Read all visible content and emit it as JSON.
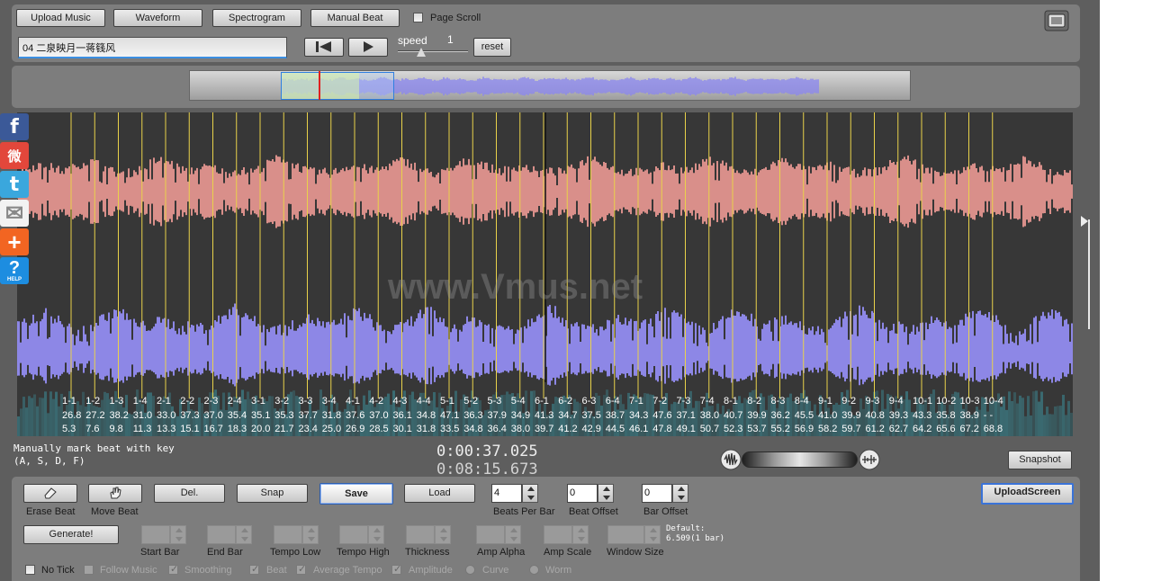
{
  "header": {
    "upload_music": "Upload Music",
    "waveform": "Waveform",
    "spectrogram": "Spectrogram",
    "manual_beat": "Manual Beat",
    "page_scroll": "Page Scroll",
    "track_title": "04 二泉映月一蒋篯风",
    "speed_label": "speed",
    "speed_value": "1",
    "reset": "reset"
  },
  "watermark": "www.Vmus.net",
  "hint": {
    "line1": "Manually mark beat with key",
    "line2": "(A, S, D, F)"
  },
  "time": {
    "current": "0:00:37.025",
    "total": "0:08:15.673"
  },
  "snapshot": "Snapshot",
  "upload_screen": "UploadScreen",
  "tools": {
    "erase_beat": "Erase Beat",
    "move_beat": "Move Beat",
    "del": "Del.",
    "snap": "Snap",
    "save": "Save",
    "load": "Load",
    "generate": "Generate!",
    "beats_per_bar_label": "Beats Per Bar",
    "beats_per_bar_value": "4",
    "beat_offset_label": "Beat Offset",
    "beat_offset_value": "0",
    "bar_offset_label": "Bar Offset",
    "bar_offset_value": "0",
    "start_bar": "Start Bar",
    "end_bar": "End Bar",
    "tempo_low": "Tempo Low",
    "tempo_high": "Tempo High",
    "thickness": "Thickness",
    "amp_alpha": "Amp Alpha",
    "amp_scale": "Amp Scale",
    "window_size": "Window Size",
    "default_line1": "Default:",
    "default_line2": "6.509(1 bar)"
  },
  "options": {
    "no_tick": "No Tick",
    "follow_music": "Follow Music",
    "smoothing": "Smoothing",
    "beat": "Beat",
    "average_tempo": "Average Tempo",
    "amplitude": "Amplitude",
    "curve": "Curve",
    "worm": "Worm"
  },
  "social": {
    "facebook": "f",
    "weibo": "微",
    "twitter": "t",
    "mail": "✉",
    "plus": "+",
    "help": "?",
    "help_caption": "HELP"
  },
  "colors": {
    "waveform_top": "#d98f8a",
    "waveform_bottom": "#8d87e6",
    "beat_line": "#e9d24a",
    "overview_wave": "#8a86f0"
  },
  "beats": [
    {
      "label": "1-1",
      "tempo": "26.8",
      "time": "5.3"
    },
    {
      "label": "1-2",
      "tempo": "27.2",
      "time": "7.6"
    },
    {
      "label": "1-3",
      "tempo": "38.2",
      "time": "9.8"
    },
    {
      "label": "1-4",
      "tempo": "31.0",
      "time": "11.3"
    },
    {
      "label": "2-1",
      "tempo": "33.0",
      "time": "13.3"
    },
    {
      "label": "2-2",
      "tempo": "37.3",
      "time": "15.1"
    },
    {
      "label": "2-3",
      "tempo": "37.0",
      "time": "16.7"
    },
    {
      "label": "2-4",
      "tempo": "35.4",
      "time": "18.3"
    },
    {
      "label": "3-1",
      "tempo": "35.1",
      "time": "20.0"
    },
    {
      "label": "3-2",
      "tempo": "35.3",
      "time": "21.7"
    },
    {
      "label": "3-3",
      "tempo": "37.7",
      "time": "23.4"
    },
    {
      "label": "3-4",
      "tempo": "31.8",
      "time": "25.0"
    },
    {
      "label": "4-1",
      "tempo": "37.6",
      "time": "26.9"
    },
    {
      "label": "4-2",
      "tempo": "37.0",
      "time": "28.5"
    },
    {
      "label": "4-3",
      "tempo": "36.1",
      "time": "30.1"
    },
    {
      "label": "4-4",
      "tempo": "34.8",
      "time": "31.8"
    },
    {
      "label": "5-1",
      "tempo": "47.1",
      "time": "33.5"
    },
    {
      "label": "5-2",
      "tempo": "36.3",
      "time": "34.8"
    },
    {
      "label": "5-3",
      "tempo": "37.9",
      "time": "36.4"
    },
    {
      "label": "5-4",
      "tempo": "34.9",
      "time": "38.0"
    },
    {
      "label": "6-1",
      "tempo": "41.3",
      "time": "39.7"
    },
    {
      "label": "6-2",
      "tempo": "34.7",
      "time": "41.2"
    },
    {
      "label": "6-3",
      "tempo": "37.5",
      "time": "42.9"
    },
    {
      "label": "6-4",
      "tempo": "38.7",
      "time": "44.5"
    },
    {
      "label": "7-1",
      "tempo": "34.3",
      "time": "46.1"
    },
    {
      "label": "7-2",
      "tempo": "47.6",
      "time": "47.8"
    },
    {
      "label": "7-3",
      "tempo": "37.1",
      "time": "49.1"
    },
    {
      "label": "7-4",
      "tempo": "38.0",
      "time": "50.7"
    },
    {
      "label": "8-1",
      "tempo": "40.7",
      "time": "52.3"
    },
    {
      "label": "8-2",
      "tempo": "39.9",
      "time": "53.7"
    },
    {
      "label": "8-3",
      "tempo": "36.2",
      "time": "55.2"
    },
    {
      "label": "8-4",
      "tempo": "45.5",
      "time": "56.9"
    },
    {
      "label": "9-1",
      "tempo": "41.0",
      "time": "58.2"
    },
    {
      "label": "9-2",
      "tempo": "39.9",
      "time": "59.7"
    },
    {
      "label": "9-3",
      "tempo": "40.8",
      "time": "61.2"
    },
    {
      "label": "9-4",
      "tempo": "39.3",
      "time": "62.7"
    },
    {
      "label": "10-1",
      "tempo": "43.3",
      "time": "64.2"
    },
    {
      "label": "10-2",
      "tempo": "35.8",
      "time": "65.6"
    },
    {
      "label": "10-3",
      "tempo": "38.9",
      "time": "67.2"
    },
    {
      "label": "10-4",
      "tempo": "- -",
      "time": "68.8"
    }
  ]
}
